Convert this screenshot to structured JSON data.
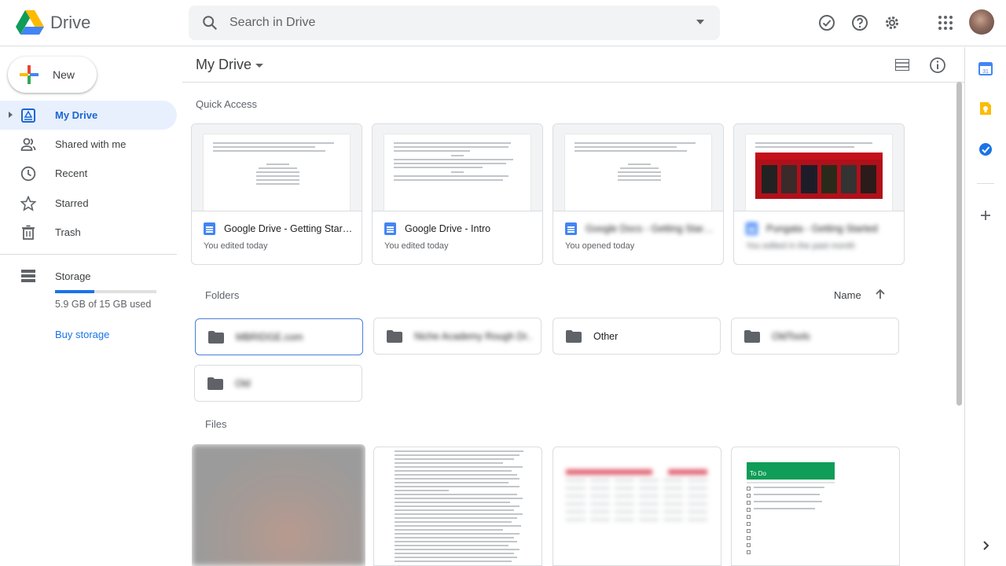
{
  "app": {
    "name": "Drive",
    "search_placeholder": "Search in Drive"
  },
  "sidebar": {
    "new_label": "New",
    "items": [
      {
        "label": "My Drive",
        "icon": "my-drive-icon",
        "active": true
      },
      {
        "label": "Shared with me",
        "icon": "shared-icon",
        "active": false
      },
      {
        "label": "Recent",
        "icon": "clock-icon",
        "active": false
      },
      {
        "label": "Starred",
        "icon": "star-icon",
        "active": false
      },
      {
        "label": "Trash",
        "icon": "trash-icon",
        "active": false
      }
    ],
    "storage": {
      "label": "Storage",
      "used_text": "5.9 GB of 15 GB used",
      "used_fraction": 0.39,
      "buy_label": "Buy storage"
    }
  },
  "main": {
    "title": "My Drive",
    "quick_access": {
      "heading": "Quick Access",
      "cards": [
        {
          "name": "Google Drive - Getting Started",
          "sub": "You edited today",
          "blurred": false
        },
        {
          "name": "Google Drive - Intro",
          "sub": "You edited today",
          "blurred": false
        },
        {
          "name": "Google Docs - Getting Started",
          "sub": "You opened today",
          "blurred": true
        },
        {
          "name": "Pungata - Getting Started",
          "sub": "You edited in the past month",
          "blurred": true
        }
      ]
    },
    "folders": {
      "heading": "Folders",
      "sort_label": "Name",
      "items": [
        {
          "name": "MBRIDGE.com",
          "blurred": true
        },
        {
          "name": "Niche Academy Rough Dr...",
          "blurred": true
        },
        {
          "name": "Other",
          "blurred": false
        },
        {
          "name": "OldTools",
          "blurred": true
        },
        {
          "name": "Old",
          "blurred": true
        }
      ]
    },
    "files": {
      "heading": "Files",
      "todo_title": "To Do"
    }
  },
  "colors": {
    "accent": "#1a73e8",
    "active_bg": "#e8f0fe",
    "doc_blue": "#4285f4",
    "sheet_green": "#0f9d58"
  }
}
